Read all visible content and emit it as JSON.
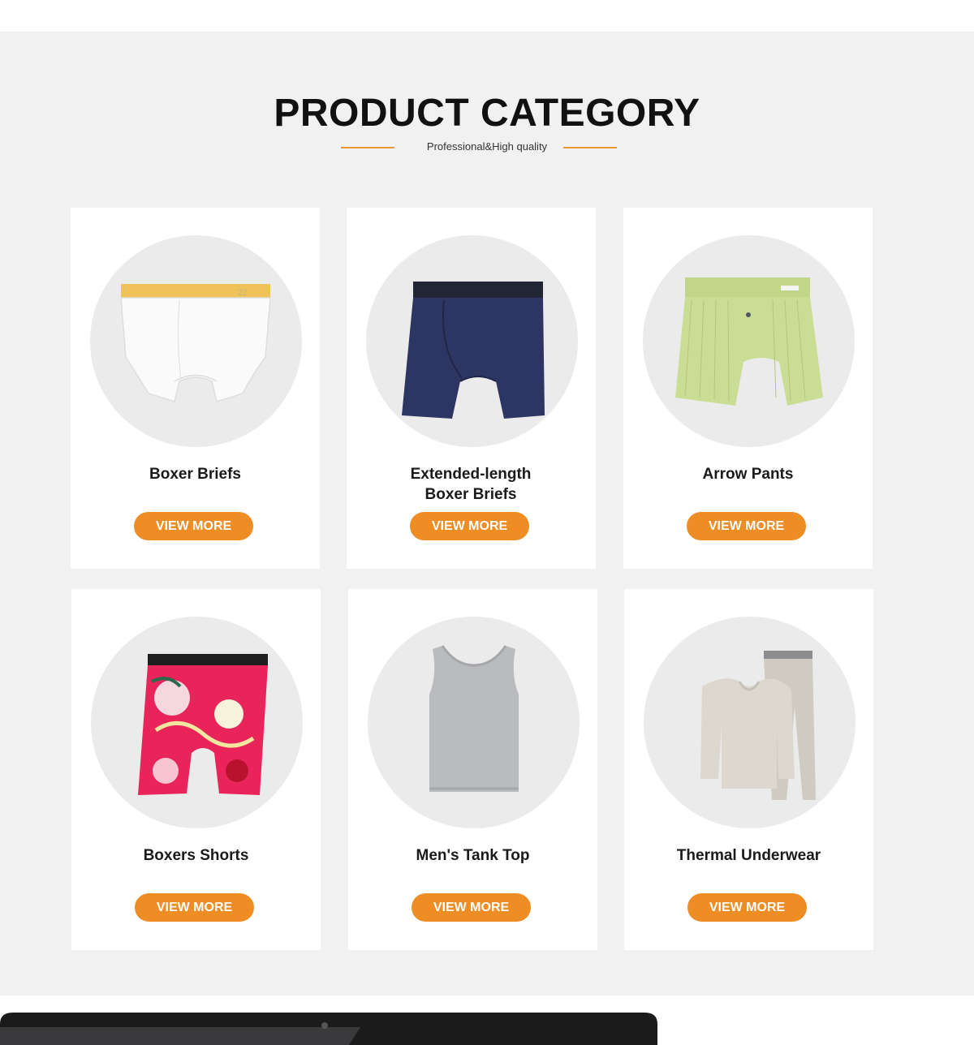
{
  "header": {
    "title": "PRODUCT CATEGORY",
    "subtitle": "Professional&High quality"
  },
  "colors": {
    "accent": "#ef8d25",
    "section_bg": "#f1f1f1",
    "card_bg": "#ffffff",
    "circle_bg": "#ebebeb"
  },
  "products": [
    {
      "name": "Boxer Briefs",
      "button": "VIEW MORE",
      "icon": "boxer-briefs-image"
    },
    {
      "name": "Extended-length Boxer Briefs",
      "button": "VIEW MORE",
      "icon": "extended-boxer-briefs-image"
    },
    {
      "name": "Arrow Pants",
      "button": "VIEW MORE",
      "icon": "arrow-pants-image"
    },
    {
      "name": "Boxers Shorts",
      "button": "VIEW MORE",
      "icon": "boxers-shorts-image"
    },
    {
      "name": "Men's Tank Top",
      "button": "VIEW MORE",
      "icon": "tank-top-image"
    },
    {
      "name": "Thermal Underwear",
      "button": "VIEW MORE",
      "icon": "thermal-underwear-image"
    }
  ]
}
